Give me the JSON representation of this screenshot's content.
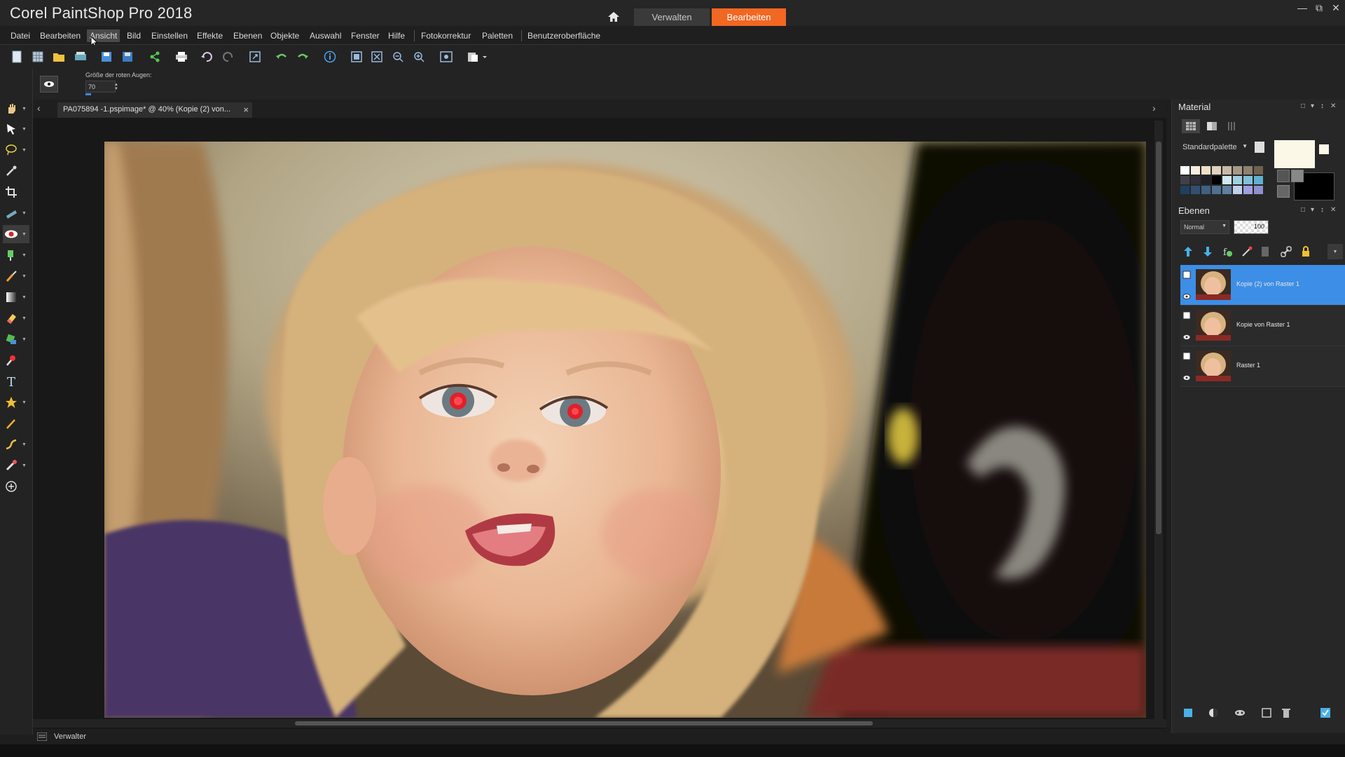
{
  "app": {
    "title": "Corel PaintShop Pro 2018",
    "workspace_tabs": [
      {
        "label": "Verwalten",
        "active": false
      },
      {
        "label": "Bearbeiten",
        "active": true
      }
    ],
    "accent_color": "#f26722"
  },
  "menu": {
    "items": [
      "Datei",
      "Bearbeiten",
      "Ansicht",
      "Bild",
      "Einstellen",
      "Effekte",
      "Ebenen",
      "Objekte",
      "Auswahl",
      "Fenster",
      "Hilfe",
      "Fotokorrektur",
      "Paletten",
      "Benutzeroberfläche"
    ],
    "active_index": 2
  },
  "toolbar": {
    "icons": [
      "new-icon",
      "new-from-template-icon",
      "open-icon",
      "scan-icon",
      "save-icon",
      "save-as-icon",
      "share-icon",
      "print-icon",
      "undo-small-icon",
      "redo-small-icon",
      "resize-icon",
      "undo-icon",
      "redo-icon",
      "info-icon",
      "fit-window-icon",
      "fit-image-icon",
      "zoom-out-icon",
      "zoom-in-icon",
      "zoom-100-icon",
      "paste-icon"
    ]
  },
  "tool_options": {
    "label": "Größe der roten Augen:",
    "value": "70"
  },
  "tools": {
    "icons": [
      "pan-icon",
      "pick-icon",
      "lasso-icon",
      "dropper-icon",
      "crop-icon",
      "straighten-icon",
      "red-eye-icon",
      "clone-icon",
      "paintbrush-icon",
      "gradient-icon",
      "eraser-icon",
      "fill-icon",
      "color-replacer-icon",
      "text-icon",
      "preset-shape-icon",
      "pen-icon",
      "warp-brush-icon",
      "picture-tube-icon",
      "add-tool-icon"
    ],
    "active_index": 6
  },
  "document": {
    "tab_title": "PA075894 -1.pspimage* @  40% (Kopie (2) von..."
  },
  "bottom": {
    "organizer_label": "Verwalter"
  },
  "material_panel": {
    "title": "Material",
    "palette_select": "Standardpalette",
    "swatches": [
      "#ffffff",
      "#f7eee0",
      "#f0e0c8",
      "#e0d0c0",
      "#c8b8a8",
      "#a89888",
      "#908070",
      "#706050",
      "#404048",
      "#303038",
      "#202028",
      "#000000",
      "#d0e8f0",
      "#a0d0e0",
      "#80c0d8",
      "#60b0d0",
      "#204060",
      "#305070",
      "#406080",
      "#507090",
      "#6080a0",
      "#c0d0e8",
      "#a0a0e0",
      "#9090d0"
    ],
    "foreground_color": "#fbf8e8",
    "background_color": "#000000"
  },
  "layers_panel": {
    "title": "Ebenen",
    "blend_mode": "Normal",
    "opacity": "100",
    "layers": [
      {
        "name": "Kopie (2) von Raster 1",
        "selected": true
      },
      {
        "name": "Kopie von Raster 1",
        "selected": false
      },
      {
        "name": "Raster 1",
        "selected": false
      }
    ]
  }
}
